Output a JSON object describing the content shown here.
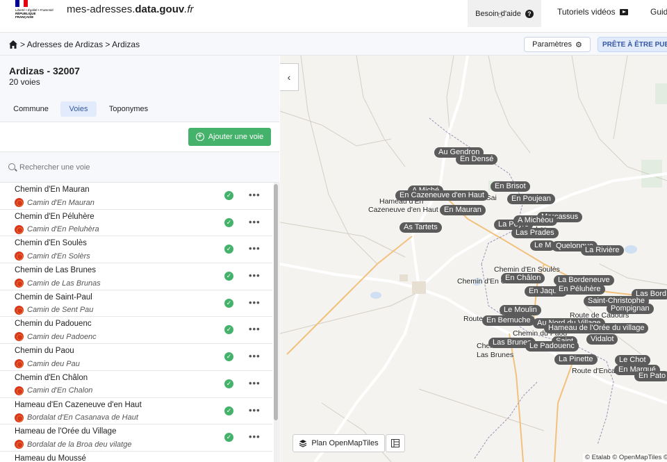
{
  "header": {
    "logo_line1": "Liberté • Égalité • Fraternité",
    "logo_line2": "RÉPUBLIQUE FRANÇAISE",
    "site_prefix": "mes-adresses.",
    "site_bold": "data.gouv",
    "site_suffix": ".fr",
    "help_label": "Besoin d'aide",
    "tutorials_label": "Tutoriels vidéos",
    "guide_label": "Guid"
  },
  "breadcrumb": {
    "path": "> Adresses de Ardizas > Ardizas",
    "params_label": "Paramètres",
    "publish_label": "PRÊTE À ÊTRE PUBLI"
  },
  "commune": {
    "name": "Ardizas - 32007",
    "count": "20 voies"
  },
  "tabs": [
    {
      "label": "Commune"
    },
    {
      "label": "Voies"
    },
    {
      "label": "Toponymes"
    }
  ],
  "add_label": "Ajouter une voie",
  "search": {
    "placeholder": "Rechercher une voie"
  },
  "voies": [
    {
      "name": "Chemin d'En Mauran",
      "occ": "Camin d'En Mauran"
    },
    {
      "name": "Chemin d'En Péluhère",
      "occ": "Camin d'En Peluhèra"
    },
    {
      "name": "Chemin d'En Soulès",
      "occ": "Camin d'En Solèrs"
    },
    {
      "name": "Chemin de Las Brunes",
      "occ": "Camin de Las Brunas"
    },
    {
      "name": "Chemin de Saint-Paul",
      "occ": "Camin de Sent Pau"
    },
    {
      "name": "Chemin du Padouenc",
      "occ": "Camin deu Padoenc"
    },
    {
      "name": "Chemin du Paou",
      "occ": "Camin deu Pau"
    },
    {
      "name": "Chemin d'En Châlon",
      "occ": "Camin d'En Chalon"
    },
    {
      "name": "Hameau d'En Cazeneuve d'en Haut",
      "occ": "Bordalat d'En Casanava de Haut"
    },
    {
      "name": "Hameau de l'Orée du Village",
      "occ": "Bordalat de la Broa deu vilatge"
    },
    {
      "name": "Hameau du Moussé",
      "occ": ""
    }
  ],
  "map": {
    "labels": [
      {
        "text": "Au Gendron"
      },
      {
        "text": "En Densé"
      },
      {
        "text": "En Brisot"
      },
      {
        "text": "A Miché"
      },
      {
        "text": "En Cazeneuve d'en Haut"
      },
      {
        "text": "En Poujean"
      },
      {
        "text": "En Mauran"
      },
      {
        "text": "Marcassus"
      },
      {
        "text": "La Peyre"
      },
      {
        "text": "A Michèou"
      },
      {
        "text": "As Tartets"
      },
      {
        "text": "Las Prades"
      },
      {
        "text": "Le M"
      },
      {
        "text": "Quelongue"
      },
      {
        "text": "La Rivière"
      },
      {
        "text": "En Châlon"
      },
      {
        "text": "La Bordeneuve"
      },
      {
        "text": "En Jaquet"
      },
      {
        "text": "En Péluhère"
      },
      {
        "text": "Las Bord"
      },
      {
        "text": "Saint-Christophe"
      },
      {
        "text": "Pompignan"
      },
      {
        "text": "Le Moulin"
      },
      {
        "text": "En Bernuche"
      },
      {
        "text": "Au Nord du Village"
      },
      {
        "text": "Hameau de l'Orée du village"
      },
      {
        "text": "Vidalot"
      },
      {
        "text": "Las Brunes"
      },
      {
        "text": "Saint"
      },
      {
        "text": "Le Padouenc"
      },
      {
        "text": "La Pinette"
      },
      {
        "text": "Le Chot"
      },
      {
        "text": "En Marqué"
      },
      {
        "text": "En Pato"
      }
    ],
    "texts": [
      {
        "text": "Hameau d'En"
      },
      {
        "text": "Cazeneuve d'en Haut"
      },
      {
        "text": "Chemin d'En Soulès"
      },
      {
        "text": "Chemin d'En Châlon"
      },
      {
        "text": "Route de Cadours"
      },
      {
        "text": "Route"
      },
      {
        "text": "Chemin du Paou"
      },
      {
        "text": "Chemi"
      },
      {
        "text": "Las Brunes"
      },
      {
        "text": "Route d'Encau"
      },
      {
        "text": "de Sai"
      },
      {
        "text": "Lar"
      }
    ],
    "plan_label": "Plan OpenMapTiles",
    "attribution": "© Etalab © OpenMapTiles ©"
  },
  "colors": {
    "accent": "#3558a2",
    "green": "#45b26b",
    "label_bg": "#5b5b5b"
  }
}
